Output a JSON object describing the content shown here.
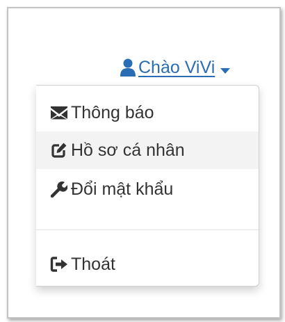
{
  "user_menu": {
    "greeting": "Chào ViVi",
    "toggle_icon": "user-icon",
    "caret_icon": "caret-down-icon"
  },
  "dropdown": {
    "items": [
      {
        "label": "Thông báo",
        "icon": "envelope-icon"
      },
      {
        "label": "Hồ sơ cá nhân",
        "icon": "edit-icon",
        "hovered": true
      },
      {
        "label": "Đổi mật khẩu",
        "icon": "wrench-icon"
      }
    ],
    "logout": {
      "label": "Thoát",
      "icon": "sign-out-icon"
    }
  },
  "colors": {
    "link": "#2a6db5",
    "menu_text": "#333333",
    "hover_bg": "#f3f3f3"
  }
}
